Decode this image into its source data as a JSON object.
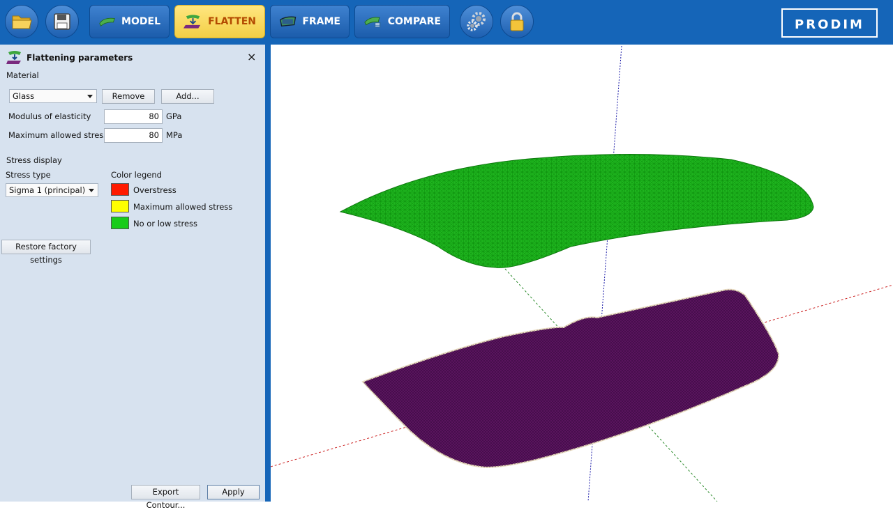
{
  "toolbar": {
    "icons": [
      "open-folder-icon",
      "save-disk-icon",
      "settings-gears-icon",
      "lock-icon"
    ],
    "modes": [
      {
        "label": "MODEL",
        "active": false
      },
      {
        "label": "FLATTEN",
        "active": true
      },
      {
        "label": "FRAME",
        "active": false
      },
      {
        "label": "COMPARE",
        "active": false
      }
    ],
    "logo": "PRODIM",
    "colors": {
      "bar": "#1565b8",
      "active_mode": "#f5d45a",
      "active_text": "#b34a00"
    }
  },
  "panel": {
    "title": "Flattening parameters",
    "close_symbol": "×",
    "material_label": "Material",
    "material_value": "Glass",
    "remove_label": "Remove",
    "add_label": "Add...",
    "modulus_label": "Modulus of elasticity",
    "modulus_value": "80",
    "modulus_unit": "GPa",
    "max_stress_label": "Maximum allowed stress",
    "max_stress_value": "80",
    "max_stress_unit": "MPa",
    "stress_display_label": "Stress display",
    "stress_type_label": "Stress type",
    "stress_type_value": "Sigma 1 (principal)",
    "color_legend_label": "Color legend",
    "legend": [
      {
        "label": "Overstress",
        "color": "#ff1a00"
      },
      {
        "label": "Maximum allowed stress",
        "color": "#ffff00"
      },
      {
        "label": "No or low stress",
        "color": "#19cc19"
      }
    ],
    "restore_label": "Restore factory settings",
    "export_label": "Export Contour...",
    "apply_label": "Apply"
  },
  "viewport": {
    "upper_mesh_color": "#1fb51f",
    "flat_mesh_color": "#5a145e",
    "axis_colors": {
      "x": "#cc2222",
      "y": "#2a8a2a",
      "z": "#1a1aa8"
    }
  }
}
